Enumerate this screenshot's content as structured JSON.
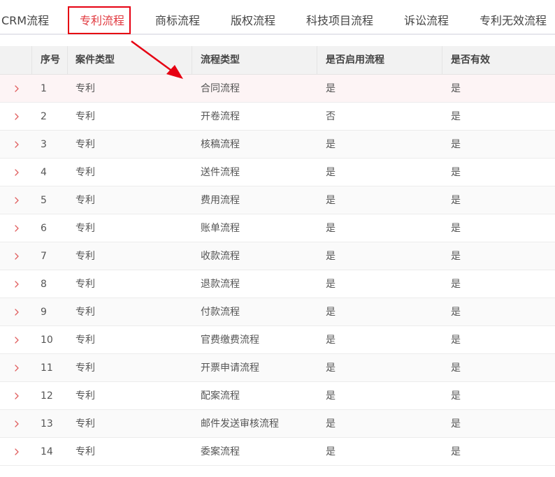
{
  "tabs": [
    {
      "label": "CRM流程",
      "active": false
    },
    {
      "label": "专利流程",
      "active": true
    },
    {
      "label": "商标流程",
      "active": false
    },
    {
      "label": "版权流程",
      "active": false
    },
    {
      "label": "科技项目流程",
      "active": false
    },
    {
      "label": "诉讼流程",
      "active": false
    },
    {
      "label": "专利无效流程",
      "active": false
    }
  ],
  "table": {
    "headers": {
      "seq": "序号",
      "case_type": "案件类型",
      "flow_type": "流程类型",
      "enabled": "是否启用流程",
      "valid": "是否有效"
    },
    "rows": [
      {
        "seq": "1",
        "case_type": "专利",
        "flow_type": "合同流程",
        "enabled": "是",
        "valid": "是"
      },
      {
        "seq": "2",
        "case_type": "专利",
        "flow_type": "开卷流程",
        "enabled": "否",
        "valid": "是"
      },
      {
        "seq": "3",
        "case_type": "专利",
        "flow_type": "核稿流程",
        "enabled": "是",
        "valid": "是"
      },
      {
        "seq": "4",
        "case_type": "专利",
        "flow_type": "送件流程",
        "enabled": "是",
        "valid": "是"
      },
      {
        "seq": "5",
        "case_type": "专利",
        "flow_type": "费用流程",
        "enabled": "是",
        "valid": "是"
      },
      {
        "seq": "6",
        "case_type": "专利",
        "flow_type": "账单流程",
        "enabled": "是",
        "valid": "是"
      },
      {
        "seq": "7",
        "case_type": "专利",
        "flow_type": "收款流程",
        "enabled": "是",
        "valid": "是"
      },
      {
        "seq": "8",
        "case_type": "专利",
        "flow_type": "退款流程",
        "enabled": "是",
        "valid": "是"
      },
      {
        "seq": "9",
        "case_type": "专利",
        "flow_type": "付款流程",
        "enabled": "是",
        "valid": "是"
      },
      {
        "seq": "10",
        "case_type": "专利",
        "flow_type": "官费缴费流程",
        "enabled": "是",
        "valid": "是"
      },
      {
        "seq": "11",
        "case_type": "专利",
        "flow_type": "开票申请流程",
        "enabled": "是",
        "valid": "是"
      },
      {
        "seq": "12",
        "case_type": "专利",
        "flow_type": "配案流程",
        "enabled": "是",
        "valid": "是"
      },
      {
        "seq": "13",
        "case_type": "专利",
        "flow_type": "邮件发送审核流程",
        "enabled": "是",
        "valid": "是"
      },
      {
        "seq": "14",
        "case_type": "专利",
        "flow_type": "委案流程",
        "enabled": "是",
        "valid": "是"
      }
    ]
  },
  "icons": {
    "expand_row": "chevron-right-icon",
    "annotation": "arrow-annotation"
  },
  "colors": {
    "accent": "#e0383e",
    "highlight_box": "#e60012",
    "chevron": "#e06060",
    "header_bg": "#f2f2f2",
    "hover_row_bg": "#fdf4f5"
  }
}
